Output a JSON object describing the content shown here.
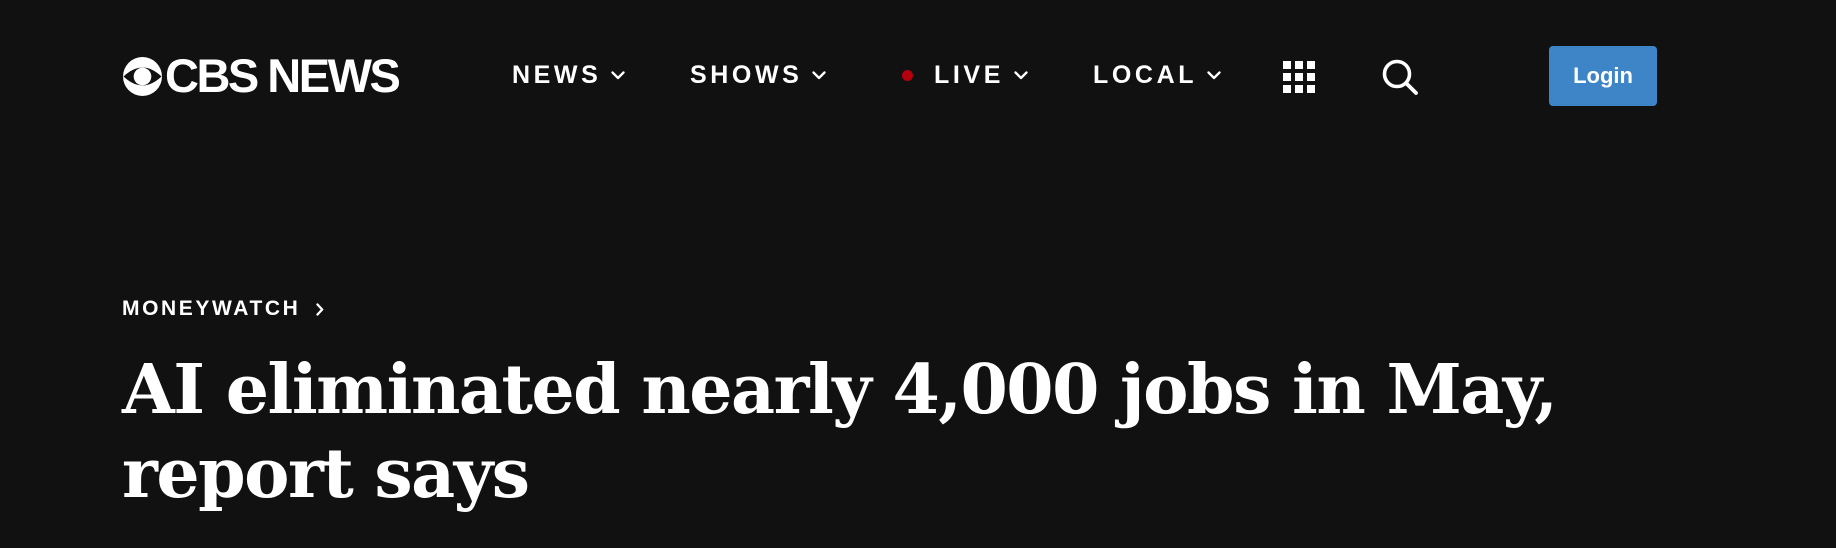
{
  "header": {
    "logo_text": "CBS NEWS",
    "nav": {
      "news": "NEWS",
      "shows": "SHOWS",
      "live": "LIVE",
      "local": "LOCAL"
    },
    "login_label": "Login",
    "icons": {
      "logo_eye": "cbs-eye-icon",
      "chevron": "chevron-down-icon",
      "live_indicator": "live-dot-icon",
      "apps": "apps-grid-icon",
      "search": "search-icon",
      "breadcrumb_chevron": "chevron-right-icon"
    },
    "colors": {
      "background": "#111111",
      "login_button": "#3d85c6",
      "live_dot": "#b5000f",
      "text": "#ffffff"
    }
  },
  "article": {
    "section": "MONEYWATCH",
    "headline": "AI eliminated nearly 4,000 jobs in May, report says"
  }
}
